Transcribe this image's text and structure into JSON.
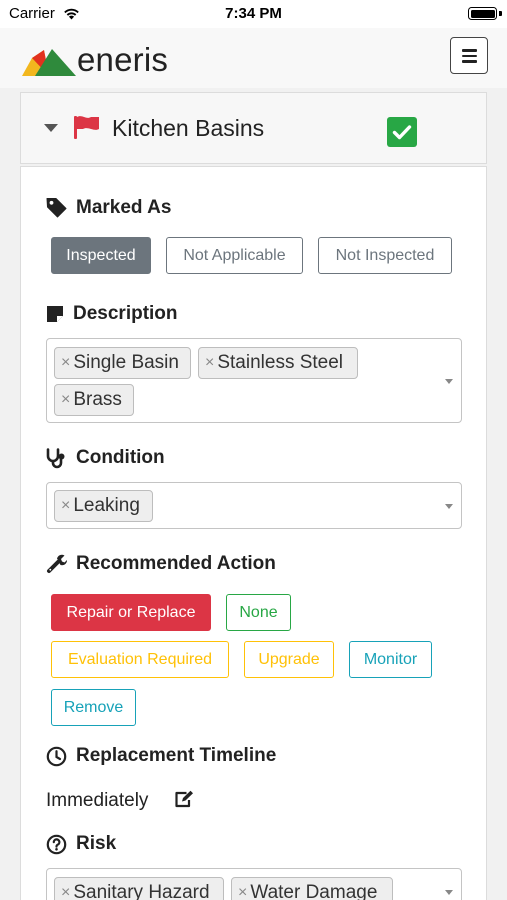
{
  "status_bar": {
    "carrier": "Carrier",
    "time": "7:34 PM"
  },
  "header": {
    "logo_text": "eneris"
  },
  "section": {
    "title": "Kitchen Basins",
    "flag_color": "#dc3545",
    "complete": true
  },
  "marked_as": {
    "title": "Marked As",
    "options": [
      {
        "label": "Inspected",
        "selected": true
      },
      {
        "label": "Not Applicable",
        "selected": false
      },
      {
        "label": "Not Inspected",
        "selected": false
      }
    ]
  },
  "description": {
    "title": "Description",
    "tags": [
      "Single Basin",
      "Stainless Steel",
      "Brass"
    ]
  },
  "condition": {
    "title": "Condition",
    "tags": [
      "Leaking"
    ]
  },
  "recommended_action": {
    "title": "Recommended Action",
    "options": [
      {
        "label": "Repair or Replace",
        "selected": true,
        "color": "#dc3545"
      },
      {
        "label": "None",
        "selected": false,
        "color": "#28a745"
      },
      {
        "label": "Evaluation Required",
        "selected": false,
        "color": "#ffc107"
      },
      {
        "label": "Upgrade",
        "selected": false,
        "color": "#ffc107"
      },
      {
        "label": "Monitor",
        "selected": false,
        "color": "#17a2b8"
      },
      {
        "label": "Remove",
        "selected": false,
        "color": "#17a2b8"
      }
    ]
  },
  "replacement_timeline": {
    "title": "Replacement Timeline",
    "value": "Immediately"
  },
  "risk": {
    "title": "Risk",
    "tags": [
      "Sanitary Hazard",
      "Water Damage"
    ]
  },
  "tag_remove_glyph": "×"
}
